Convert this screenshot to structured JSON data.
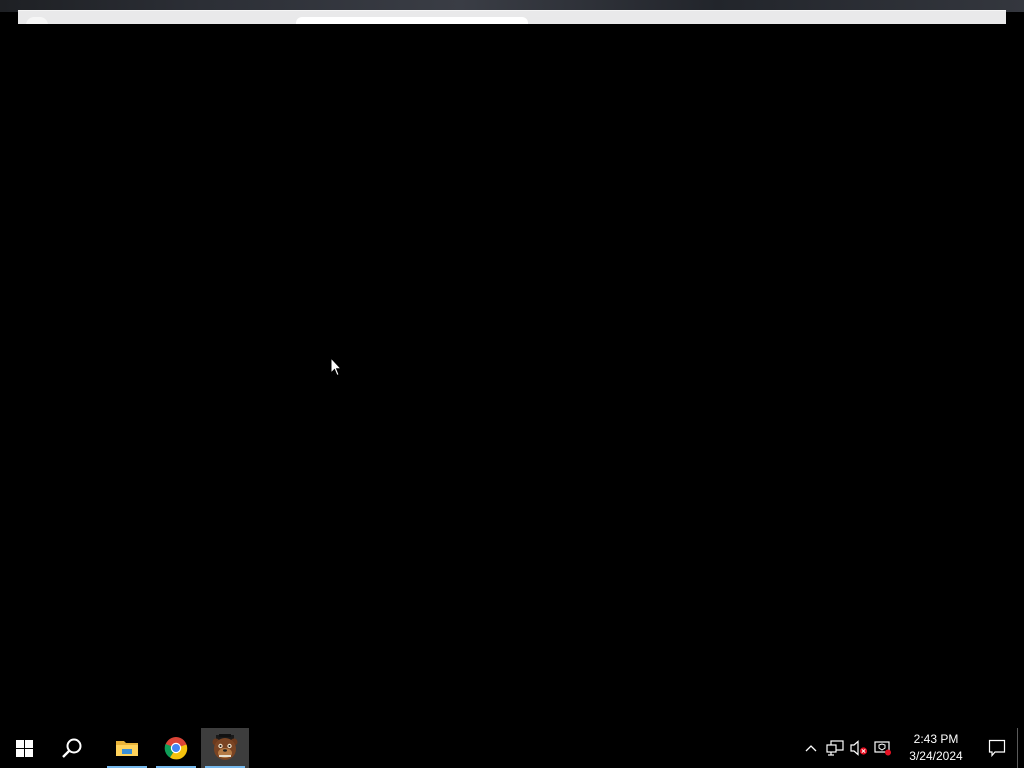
{
  "taskbar": {
    "start_icon": "windows-logo-icon",
    "search_icon": "search-icon",
    "pinned": [
      {
        "name": "file-explorer",
        "icon": "folder-icon",
        "running": true
      },
      {
        "name": "chrome",
        "icon": "chrome-icon",
        "running": true
      },
      {
        "name": "fnaf-game",
        "icon": "freddy-icon",
        "running": true,
        "active": true
      }
    ],
    "tray": {
      "overflow_icon": "chevron-up-icon",
      "network_icon": "network-icon",
      "volume_icon": "volume-muted-icon",
      "defender_icon": "security-icon"
    },
    "clock": {
      "time": "2:43 PM",
      "date": "3/24/2024"
    },
    "notification_icon": "action-center-icon"
  },
  "colors": {
    "taskbar_bg": "#000000",
    "running_indicator": "#76b9ed",
    "active_bg": "#3d3d3d",
    "alert_red": "#e81123"
  }
}
